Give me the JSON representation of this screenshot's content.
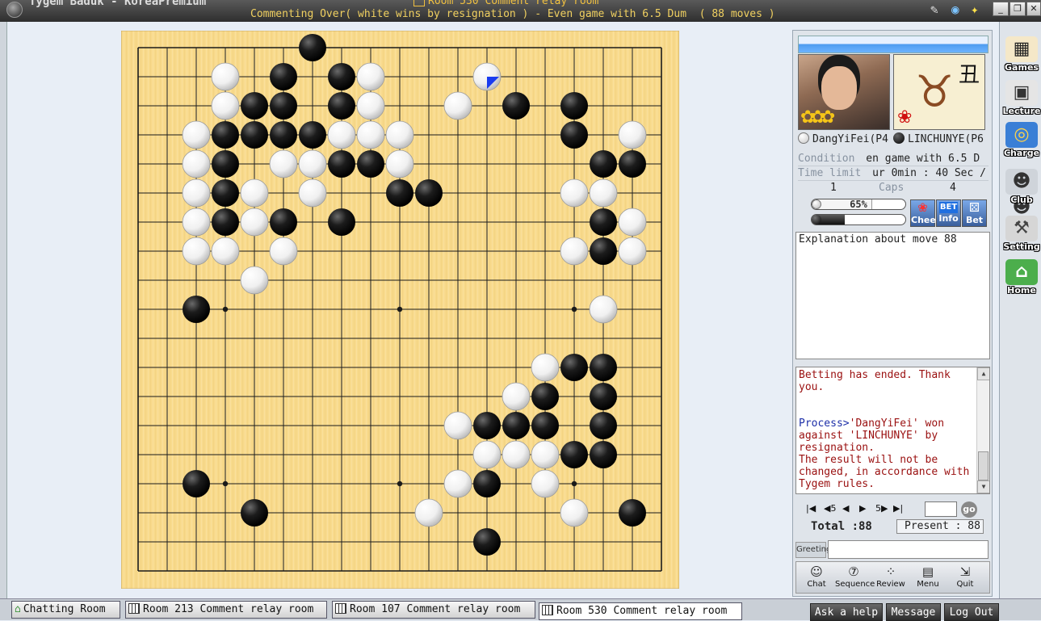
{
  "window": {
    "app_title": "Tygem Baduk - KoreaPremium",
    "room_title": "Room 530 Comment relay room",
    "status_line": "Commenting Over( white wins by resignation ) - Even game with 6.5 Dum  ( 88 moves )"
  },
  "board": {
    "size": 19,
    "black_stones": [
      [
        6,
        0
      ],
      [
        5,
        1
      ],
      [
        7,
        1
      ],
      [
        4,
        2
      ],
      [
        5,
        2
      ],
      [
        7,
        2
      ],
      [
        13,
        2
      ],
      [
        15,
        2
      ],
      [
        3,
        3
      ],
      [
        4,
        3
      ],
      [
        5,
        3
      ],
      [
        6,
        3
      ],
      [
        15,
        3
      ],
      [
        3,
        4
      ],
      [
        7,
        4
      ],
      [
        8,
        4
      ],
      [
        9,
        4
      ],
      [
        16,
        4
      ],
      [
        17,
        4
      ],
      [
        3,
        5
      ],
      [
        9,
        5
      ],
      [
        10,
        5
      ],
      [
        3,
        6
      ],
      [
        5,
        6
      ],
      [
        7,
        6
      ],
      [
        16,
        6
      ],
      [
        16,
        7
      ],
      [
        2,
        9
      ],
      [
        15,
        11
      ],
      [
        16,
        11
      ],
      [
        14,
        12
      ],
      [
        16,
        12
      ],
      [
        12,
        13
      ],
      [
        13,
        13
      ],
      [
        14,
        13
      ],
      [
        16,
        13
      ],
      [
        15,
        14
      ],
      [
        16,
        14
      ],
      [
        12,
        15
      ],
      [
        2,
        15
      ],
      [
        4,
        16
      ],
      [
        17,
        16
      ],
      [
        12,
        17
      ]
    ],
    "white_stones": [
      [
        3,
        1
      ],
      [
        8,
        1
      ],
      [
        12,
        1
      ],
      [
        3,
        2
      ],
      [
        8,
        2
      ],
      [
        11,
        2
      ],
      [
        2,
        3
      ],
      [
        7,
        3
      ],
      [
        8,
        3
      ],
      [
        9,
        3
      ],
      [
        17,
        3
      ],
      [
        2,
        4
      ],
      [
        5,
        4
      ],
      [
        6,
        4
      ],
      [
        9,
        4
      ],
      [
        2,
        5
      ],
      [
        4,
        5
      ],
      [
        6,
        5
      ],
      [
        15,
        5
      ],
      [
        16,
        5
      ],
      [
        2,
        6
      ],
      [
        4,
        6
      ],
      [
        17,
        6
      ],
      [
        2,
        7
      ],
      [
        3,
        7
      ],
      [
        5,
        7
      ],
      [
        15,
        7
      ],
      [
        17,
        7
      ],
      [
        4,
        8
      ],
      [
        16,
        9
      ],
      [
        14,
        11
      ],
      [
        13,
        12
      ],
      [
        11,
        13
      ],
      [
        12,
        14
      ],
      [
        13,
        14
      ],
      [
        14,
        14
      ],
      [
        11,
        15
      ],
      [
        14,
        15
      ],
      [
        10,
        16
      ],
      [
        15,
        16
      ]
    ],
    "last_move": [
      12,
      1
    ],
    "colors": {
      "wood": "#f7d98a",
      "line": "#1a1a1a",
      "last_marker": "#1a3cf0"
    }
  },
  "players": {
    "white": {
      "name": "DangYiFei(P4"
    },
    "black": {
      "name": "LINCHUNYE(P6"
    },
    "zodiac_char": "丑"
  },
  "game_info": {
    "condition_label": "Condition",
    "condition_value": "en game with 6.5 D",
    "time_label": "Time limit",
    "time_value": "ur 0min : 40 Sec /",
    "white_caps": "1",
    "caps_label": "Caps",
    "black_caps": "4"
  },
  "win_prob": {
    "white": "65%",
    "black": "35%",
    "white_fraction": 0.65,
    "black_fraction": 0.35
  },
  "action_buttons": {
    "cheer": "Cheer",
    "info": "Info",
    "bet": "Bet",
    "info_tag": "BET"
  },
  "explanation": "Explanation about move 88",
  "chat": [
    {
      "type": "msg",
      "text": "Betting has ended. Thank you."
    },
    {
      "type": "blank",
      "text": ""
    },
    {
      "type": "sys",
      "prefix": "Process>",
      "text": "'DangYiFei' won against 'LINCHUNYE' by resignation."
    },
    {
      "type": "msg",
      "text": "The result will not be changed, in accordance with Tygem rules."
    }
  ],
  "navigation": {
    "first": "|◀",
    "back5": "◀5",
    "back1": "◀",
    "fwd1": "▶",
    "fwd5": "5▶",
    "last": "▶|",
    "move_input": "",
    "go": "go",
    "total": "Total :88",
    "present": "Present : 88"
  },
  "greeting": {
    "label": "Greeting",
    "value": ""
  },
  "bottom_tools": [
    "Chat",
    "Sequence",
    "Review",
    "Menu",
    "Quit"
  ],
  "sidebar": [
    "Games",
    "Lecture",
    "Charge",
    "Club",
    "Setting",
    "Home"
  ],
  "taskbar": {
    "tabs": [
      "Chatting Room",
      "Room 213 Comment relay room",
      "Room 107 Comment relay room",
      "Room 530 Comment relay room"
    ],
    "buttons": [
      "Ask a help",
      "Message",
      "Log Out"
    ]
  }
}
